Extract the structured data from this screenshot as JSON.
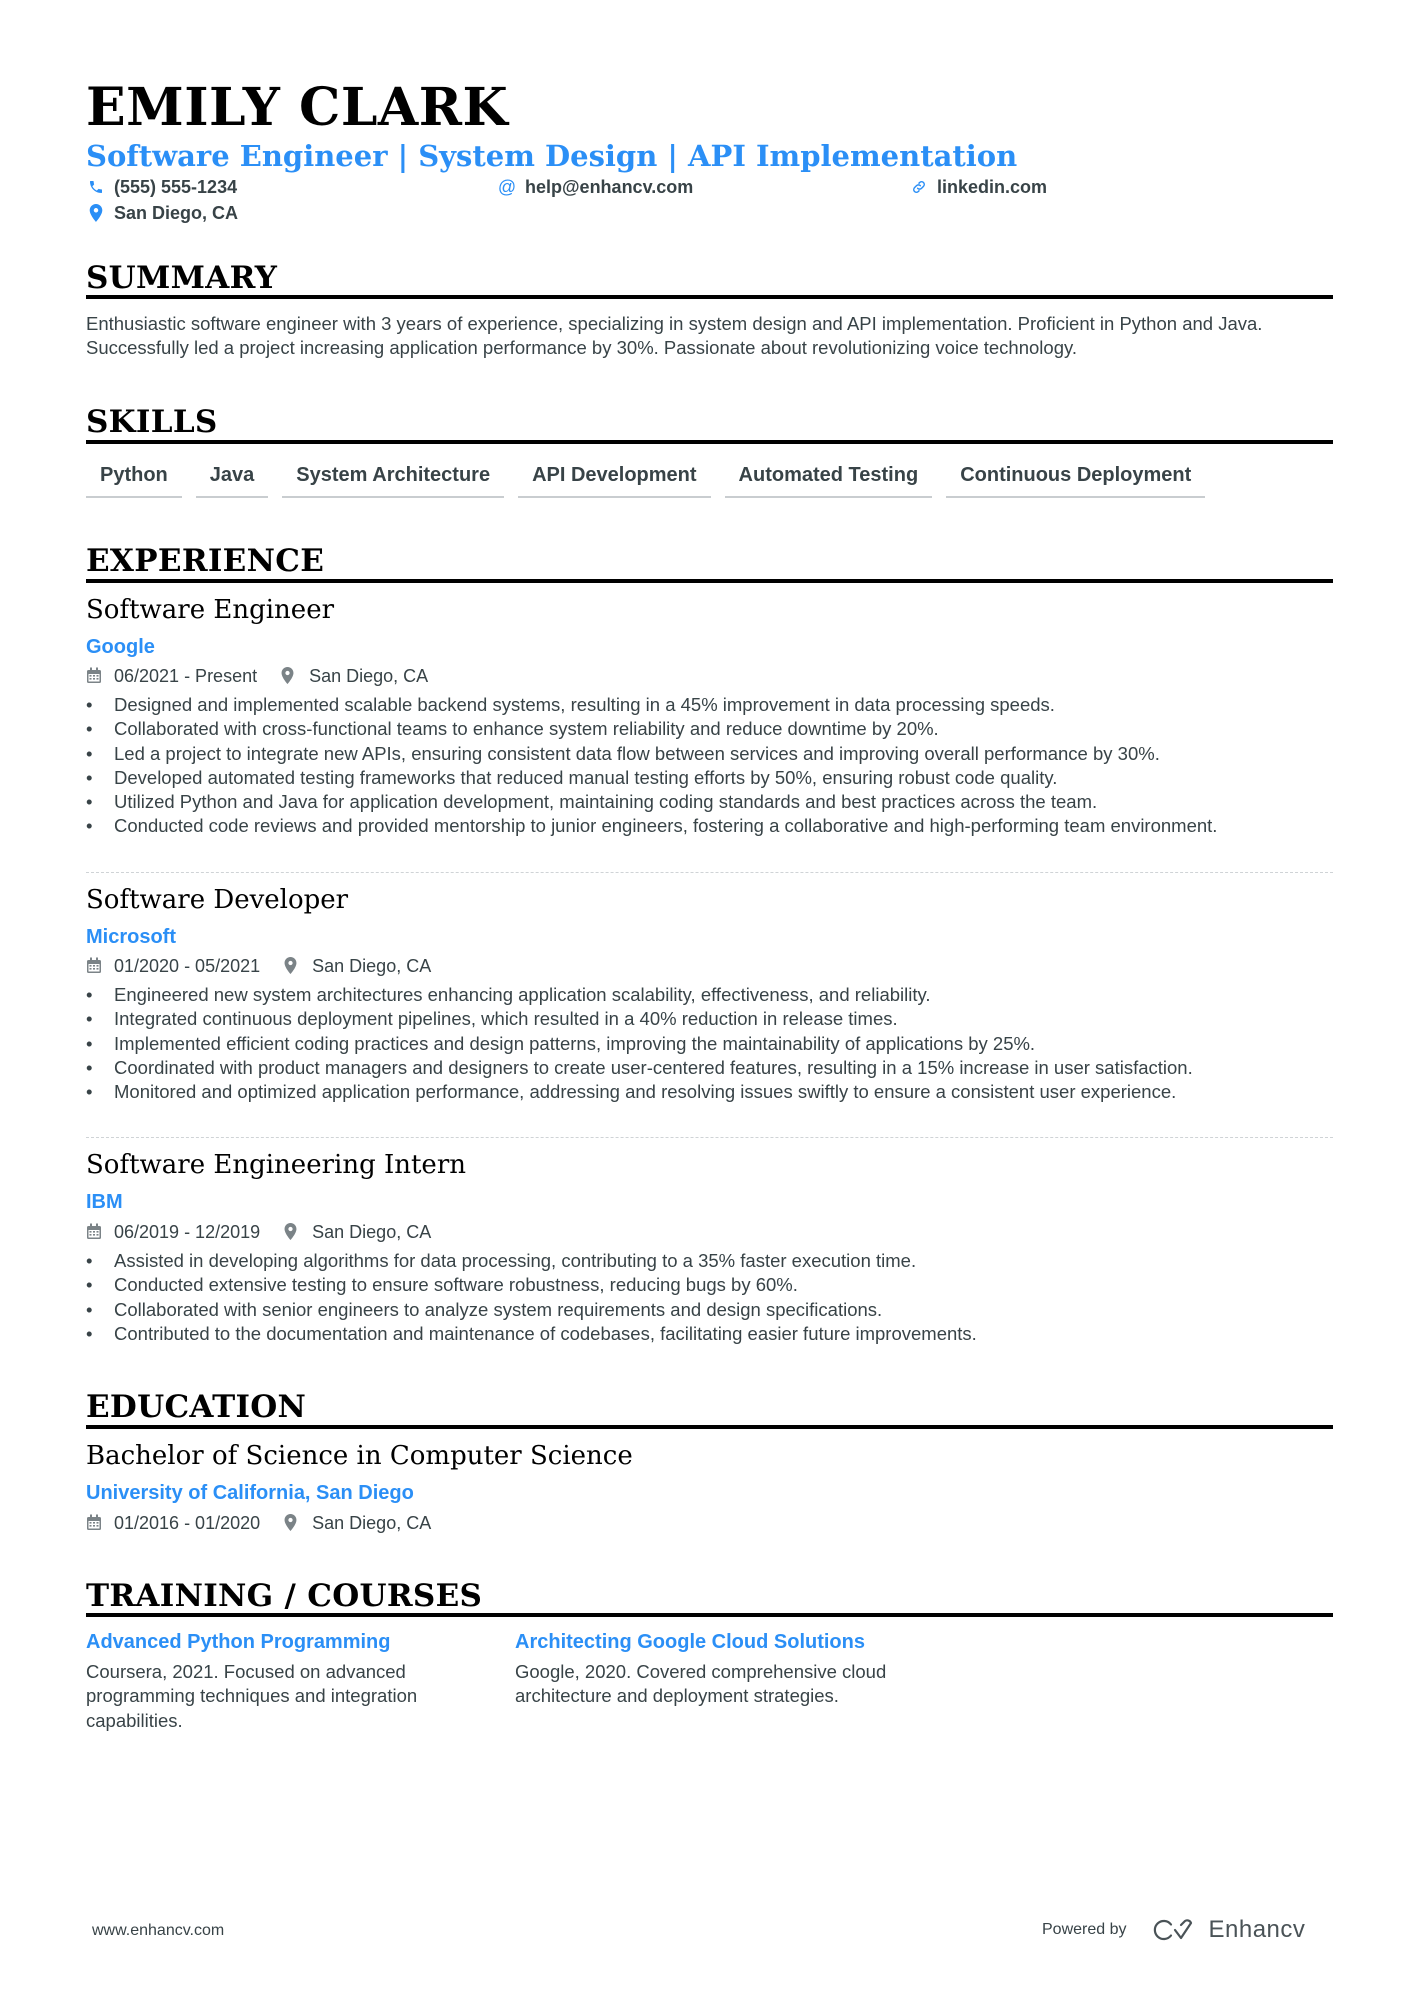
{
  "header": {
    "name": "EMILY CLARK",
    "headline": "Software Engineer | System Design | API Implementation",
    "contacts": [
      {
        "icon": "phone-icon",
        "text": "(555) 555-1234"
      },
      {
        "icon": "at-icon",
        "text": "help@enhancv.com"
      },
      {
        "icon": "link-icon",
        "text": "linkedin.com"
      },
      {
        "icon": "location-pin-icon",
        "text": "San Diego, CA"
      }
    ]
  },
  "summary": {
    "title": "SUMMARY",
    "text": "Enthusiastic software engineer with 3 years of experience, specializing in system design and API implementation. Proficient in Python and Java. Successfully led a project increasing application performance by 30%. Passionate about revolutionizing voice technology."
  },
  "skills": {
    "title": "SKILLS",
    "items": [
      "Python",
      "Java",
      "System Architecture",
      "API Development",
      "Automated Testing",
      "Continuous Deployment"
    ]
  },
  "experience": {
    "title": "EXPERIENCE",
    "jobs": [
      {
        "title": "Software Engineer",
        "company": "Google",
        "dates": "06/2021 - Present",
        "location": "San Diego, CA",
        "bullets": [
          "Designed and implemented scalable backend systems, resulting in a 45% improvement in data processing speeds.",
          "Collaborated with cross-functional teams to enhance system reliability and reduce downtime by 20%.",
          "Led a project to integrate new APIs, ensuring consistent data flow between services and improving overall performance by 30%.",
          "Developed automated testing frameworks that reduced manual testing efforts by 50%, ensuring robust code quality.",
          "Utilized Python and Java for application development, maintaining coding standards and best practices across the team.",
          "Conducted code reviews and provided mentorship to junior engineers, fostering a collaborative and high-performing team environment."
        ]
      },
      {
        "title": "Software Developer",
        "company": "Microsoft",
        "dates": "01/2020 - 05/2021",
        "location": "San Diego, CA",
        "bullets": [
          "Engineered new system architectures enhancing application scalability, effectiveness, and reliability.",
          "Integrated continuous deployment pipelines, which resulted in a 40% reduction in release times.",
          "Implemented efficient coding practices and design patterns, improving the maintainability of applications by 25%.",
          "Coordinated with product managers and designers to create user-centered features, resulting in a 15% increase in user satisfaction.",
          "Monitored and optimized application performance, addressing and resolving issues swiftly to ensure a consistent user experience."
        ]
      },
      {
        "title": "Software Engineering Intern",
        "company": "IBM",
        "dates": "06/2019 - 12/2019",
        "location": "San Diego, CA",
        "bullets": [
          "Assisted in developing algorithms for data processing, contributing to a 35% faster execution time.",
          "Conducted extensive testing to ensure software robustness, reducing bugs by 60%.",
          "Collaborated with senior engineers to analyze system requirements and design specifications.",
          "Contributed to the documentation and maintenance of codebases, facilitating easier future improvements."
        ]
      }
    ]
  },
  "education": {
    "title": "EDUCATION",
    "degree": "Bachelor of Science in Computer Science",
    "school": "University of California, San Diego",
    "dates": "01/2016 - 01/2020",
    "location": "San Diego, CA"
  },
  "training": {
    "title": "TRAINING / COURSES",
    "courses": [
      {
        "title": "Advanced Python Programming",
        "description": "Coursera, 2021. Focused on advanced programming techniques and integration capabilities."
      },
      {
        "title": "Architecting Google Cloud Solutions",
        "description": "Google, 2020. Covered comprehensive cloud architecture and deployment strategies."
      }
    ]
  },
  "footer": {
    "website": "www.enhancv.com",
    "powered_by": "Powered by",
    "brand": "Enhancv"
  },
  "colors": {
    "accent": "#2b8ff6",
    "text": "#384347",
    "heading": "#000000"
  }
}
